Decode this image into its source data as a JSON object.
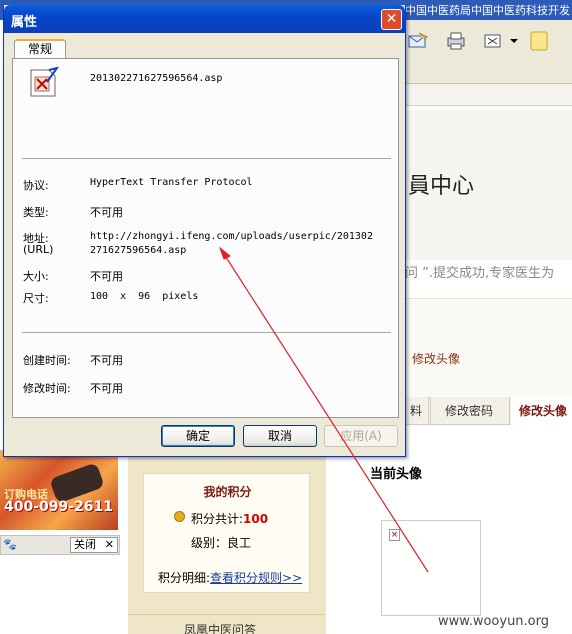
{
  "background": {
    "top_strip_text": "中国中医药局中国中医药科技开发",
    "member_title": "員中心",
    "notice_text": "问 ”.提交成功,专家医生为",
    "breadcrumb_link": "修改头像",
    "tabs": [
      "料",
      "修改密码",
      "修改头像"
    ],
    "current_avatar_label": "当前头像",
    "broken_image_glyph": "×",
    "promo": {
      "label": "订购电话",
      "phone": "400-099-2611"
    },
    "close_label": "关闭",
    "close_icon": "✕",
    "paw_icon": "🐾",
    "points": {
      "title": "我的积分",
      "total_label": "积分共计:",
      "total_value": "100",
      "level_label": "级别：",
      "level_value": "良工",
      "detail_label": "积分明细:",
      "detail_link": "查看积分规则>>"
    },
    "footer_label": "凤凰中医问答",
    "watermark": "www.wooyun.org"
  },
  "dialog": {
    "title": "属性",
    "close_glyph": "✕",
    "tab_label": "常规",
    "filename": "2013022716275965​64.asp",
    "rows": [
      {
        "label": "协议:",
        "value": "HyperText Transfer Protocol"
      },
      {
        "label": "类型:",
        "value": "不可用"
      },
      {
        "label": "地址:",
        "label2": "(URL)",
        "value": "http://zhongyi.ifeng.com/uploads/userpic/201302",
        "value2": "271627596564.asp"
      },
      {
        "label": "大小:",
        "value": "不可用"
      },
      {
        "label": "尺寸:",
        "value": "100  x  96  pixels"
      },
      {
        "label": "创建时间:",
        "value": "不可用"
      },
      {
        "label": "修改时间:",
        "value": "不可用"
      }
    ],
    "buttons": {
      "ok": "确定",
      "cancel": "取消",
      "apply": "应用(A)"
    }
  },
  "colors": {
    "titlebar": "#0a4fd4",
    "dialog_bg": "#ece9d8",
    "arrow": "#e02020",
    "accent_red": "#7b1a10",
    "link_blue": "#1a3f9a"
  }
}
